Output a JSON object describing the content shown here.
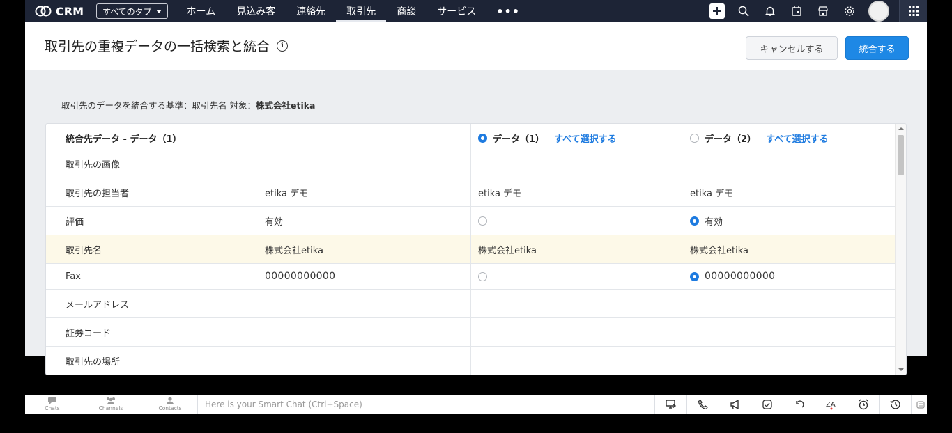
{
  "nav": {
    "brand": "CRM",
    "tabs_select": "すべてのタブ",
    "links": [
      "ホーム",
      "見込み客",
      "連絡先",
      "取引先",
      "商談",
      "サービス"
    ],
    "active_link": "取引先",
    "more": "•••",
    "icons": [
      "plus-icon",
      "search-icon",
      "bell-icon",
      "calendar-icon",
      "marketplace-icon",
      "gear-icon",
      "avatar",
      "apps-grid-icon"
    ]
  },
  "header": {
    "title": "取引先の重複データの一括検索と統合",
    "cancel_label": "キャンセルする",
    "merge_label": "統合する"
  },
  "criteria": {
    "prefix": "取引先のデータを統合する基準：取引先名 対象：",
    "target": "株式会社etika"
  },
  "table": {
    "header": {
      "label": "統合先データ - データ（1）",
      "data1_label": "データ（1）",
      "data2_label": "データ（2）",
      "select_all": "すべて選択する",
      "selected": "data1"
    },
    "rows": [
      {
        "label": "取引先の画像",
        "value": "",
        "d1": "",
        "d2": "",
        "radio": false
      },
      {
        "label": "取引先の担当者",
        "value": "etika デモ",
        "d1": "etika デモ",
        "d2": "etika デモ",
        "radio": false
      },
      {
        "label": "評価",
        "value": "有効",
        "d1": "",
        "d2": "有効",
        "radio": true,
        "selected": "d2"
      },
      {
        "label": "取引先名",
        "value": "株式会社etika",
        "d1": "株式会社etika",
        "d2": "株式会社etika",
        "radio": false,
        "highlight": true
      },
      {
        "label": "Fax",
        "value": "00000000000",
        "d1": "",
        "d2": "00000000000",
        "radio": true,
        "selected": "d2"
      },
      {
        "label": "メールアドレス",
        "value": "",
        "d1": "",
        "d2": "",
        "radio": false
      },
      {
        "label": "証券コード",
        "value": "",
        "d1": "",
        "d2": "",
        "radio": false
      },
      {
        "label": "取引先の場所",
        "value": "",
        "d1": "",
        "d2": "",
        "radio": false
      }
    ]
  },
  "bottombar": {
    "chats": "Chats",
    "channels": "Channels",
    "contacts": "Contacts",
    "smartchat_placeholder": "Here is your Smart Chat (Ctrl+Space)",
    "icons": [
      "screen-share-icon",
      "phone-icon",
      "megaphone-icon",
      "edit-icon",
      "undo-icon",
      "zia-icon",
      "alarm-icon",
      "history-icon",
      "more-icon"
    ]
  }
}
